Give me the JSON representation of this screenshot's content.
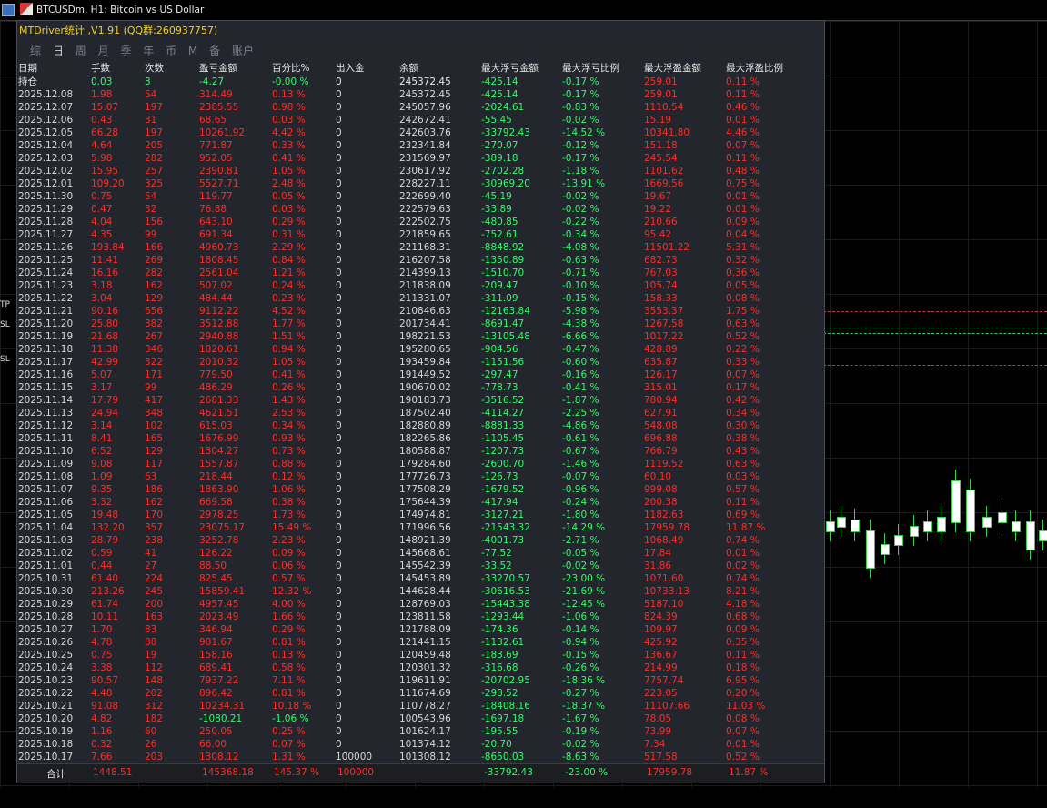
{
  "window": {
    "title": "BTCUSDm, H1:  Bitcoin vs US Dollar"
  },
  "panel": {
    "title": "MTDriver统计 ,V1.91 (QQ群:260937757)",
    "tabs": [
      "综",
      "日",
      "周",
      "月",
      "季",
      "年",
      "币",
      "M",
      "备",
      "账户"
    ],
    "active_tab": "日",
    "side_tag": "移"
  },
  "left_tags": [
    "TP",
    "SL",
    "SL"
  ],
  "table": {
    "headers": [
      "日期",
      "手数",
      "次数",
      "盈亏金额",
      "百分比%",
      "出入金",
      "余额",
      "最大浮亏金额",
      "最大浮亏比例",
      "最大浮盈金额",
      "最大浮盈比例"
    ],
    "holding": [
      "持仓",
      "0.03",
      "3",
      "-4.27",
      "-0.00 %",
      "0",
      "245372.45",
      "-425.14",
      "-0.17 %",
      "259.01",
      "0.11 %"
    ],
    "rows": [
      [
        "2025.12.08",
        "1.98",
        "54",
        "314.49",
        "0.13 %",
        "0",
        "245372.45",
        "-425.14",
        "-0.17 %",
        "259.01",
        "0.11 %"
      ],
      [
        "2025.12.07",
        "15.07",
        "197",
        "2385.55",
        "0.98 %",
        "0",
        "245057.96",
        "-2024.61",
        "-0.83 %",
        "1110.54",
        "0.46 %"
      ],
      [
        "2025.12.06",
        "0.43",
        "31",
        "68.65",
        "0.03 %",
        "0",
        "242672.41",
        "-55.45",
        "-0.02 %",
        "15.19",
        "0.01 %"
      ],
      [
        "2025.12.05",
        "66.28",
        "197",
        "10261.92",
        "4.42 %",
        "0",
        "242603.76",
        "-33792.43",
        "-14.52 %",
        "10341.80",
        "4.46 %"
      ],
      [
        "2025.12.04",
        "4.64",
        "205",
        "771.87",
        "0.33 %",
        "0",
        "232341.84",
        "-270.07",
        "-0.12 %",
        "151.18",
        "0.07 %"
      ],
      [
        "2025.12.03",
        "5.98",
        "282",
        "952.05",
        "0.41 %",
        "0",
        "231569.97",
        "-389.18",
        "-0.17 %",
        "245.54",
        "0.11 %"
      ],
      [
        "2025.12.02",
        "15.95",
        "257",
        "2390.81",
        "1.05 %",
        "0",
        "230617.92",
        "-2702.28",
        "-1.18 %",
        "1101.62",
        "0.48 %"
      ],
      [
        "2025.12.01",
        "109.20",
        "325",
        "5527.71",
        "2.48 %",
        "0",
        "228227.11",
        "-30969.20",
        "-13.91 %",
        "1669.56",
        "0.75 %"
      ],
      [
        "2025.11.30",
        "0.75",
        "54",
        "119.77",
        "0.05 %",
        "0",
        "222699.40",
        "-45.19",
        "-0.02 %",
        "19.67",
        "0.01 %"
      ],
      [
        "2025.11.29",
        "0.47",
        "32",
        "76.88",
        "0.03 %",
        "0",
        "222579.63",
        "-33.89",
        "-0.02 %",
        "19.22",
        "0.01 %"
      ],
      [
        "2025.11.28",
        "4.04",
        "156",
        "643.10",
        "0.29 %",
        "0",
        "222502.75",
        "-480.85",
        "-0.22 %",
        "210.66",
        "0.09 %"
      ],
      [
        "2025.11.27",
        "4.35",
        "99",
        "691.34",
        "0.31 %",
        "0",
        "221859.65",
        "-752.61",
        "-0.34 %",
        "95.42",
        "0.04 %"
      ],
      [
        "2025.11.26",
        "193.84",
        "166",
        "4960.73",
        "2.29 %",
        "0",
        "221168.31",
        "-8848.92",
        "-4.08 %",
        "11501.22",
        "5.31 %"
      ],
      [
        "2025.11.25",
        "11.41",
        "269",
        "1808.45",
        "0.84 %",
        "0",
        "216207.58",
        "-1350.89",
        "-0.63 %",
        "682.73",
        "0.32 %"
      ],
      [
        "2025.11.24",
        "16.16",
        "282",
        "2561.04",
        "1.21 %",
        "0",
        "214399.13",
        "-1510.70",
        "-0.71 %",
        "767.03",
        "0.36 %"
      ],
      [
        "2025.11.23",
        "3.18",
        "162",
        "507.02",
        "0.24 %",
        "0",
        "211838.09",
        "-209.47",
        "-0.10 %",
        "105.74",
        "0.05 %"
      ],
      [
        "2025.11.22",
        "3.04",
        "129",
        "484.44",
        "0.23 %",
        "0",
        "211331.07",
        "-311.09",
        "-0.15 %",
        "158.33",
        "0.08 %"
      ],
      [
        "2025.11.21",
        "90.16",
        "656",
        "9112.22",
        "4.52 %",
        "0",
        "210846.63",
        "-12163.84",
        "-5.98 %",
        "3553.37",
        "1.75 %"
      ],
      [
        "2025.11.20",
        "25.80",
        "382",
        "3512.88",
        "1.77 %",
        "0",
        "201734.41",
        "-8691.47",
        "-4.38 %",
        "1267.58",
        "0.63 %"
      ],
      [
        "2025.11.19",
        "21.68",
        "267",
        "2940.88",
        "1.51 %",
        "0",
        "198221.53",
        "-13105.48",
        "-6.66 %",
        "1017.22",
        "0.52 %"
      ],
      [
        "2025.11.18",
        "11.38",
        "346",
        "1820.61",
        "0.94 %",
        "0",
        "195280.65",
        "-904.56",
        "-0.47 %",
        "428.89",
        "0.22 %"
      ],
      [
        "2025.11.17",
        "42.99",
        "322",
        "2010.32",
        "1.05 %",
        "0",
        "193459.84",
        "-1151.56",
        "-0.60 %",
        "635.87",
        "0.33 %"
      ],
      [
        "2025.11.16",
        "5.07",
        "171",
        "779.50",
        "0.41 %",
        "0",
        "191449.52",
        "-297.47",
        "-0.16 %",
        "126.17",
        "0.07 %"
      ],
      [
        "2025.11.15",
        "3.17",
        "99",
        "486.29",
        "0.26 %",
        "0",
        "190670.02",
        "-778.73",
        "-0.41 %",
        "315.01",
        "0.17 %"
      ],
      [
        "2025.11.14",
        "17.79",
        "417",
        "2681.33",
        "1.43 %",
        "0",
        "190183.73",
        "-3516.52",
        "-1.87 %",
        "780.94",
        "0.42 %"
      ],
      [
        "2025.11.13",
        "24.94",
        "348",
        "4621.51",
        "2.53 %",
        "0",
        "187502.40",
        "-4114.27",
        "-2.25 %",
        "627.91",
        "0.34 %"
      ],
      [
        "2025.11.12",
        "3.14",
        "102",
        "615.03",
        "0.34 %",
        "0",
        "182880.89",
        "-8881.33",
        "-4.86 %",
        "548.08",
        "0.30 %"
      ],
      [
        "2025.11.11",
        "8.41",
        "165",
        "1676.99",
        "0.93 %",
        "0",
        "182265.86",
        "-1105.45",
        "-0.61 %",
        "696.88",
        "0.38 %"
      ],
      [
        "2025.11.10",
        "6.52",
        "129",
        "1304.27",
        "0.73 %",
        "0",
        "180588.87",
        "-1207.73",
        "-0.67 %",
        "766.79",
        "0.43 %"
      ],
      [
        "2025.11.09",
        "9.08",
        "117",
        "1557.87",
        "0.88 %",
        "0",
        "179284.60",
        "-2600.70",
        "-1.46 %",
        "1119.52",
        "0.63 %"
      ],
      [
        "2025.11.08",
        "1.09",
        "63",
        "218.44",
        "0.12 %",
        "0",
        "177726.73",
        "-126.73",
        "-0.07 %",
        "60.10",
        "0.03 %"
      ],
      [
        "2025.11.07",
        "9.35",
        "186",
        "1863.90",
        "1.06 %",
        "0",
        "177508.29",
        "-1679.52",
        "-0.96 %",
        "999.08",
        "0.57 %"
      ],
      [
        "2025.11.06",
        "3.32",
        "162",
        "669.58",
        "0.38 %",
        "0",
        "175644.39",
        "-417.94",
        "-0.24 %",
        "200.38",
        "0.11 %"
      ],
      [
        "2025.11.05",
        "19.48",
        "170",
        "2978.25",
        "1.73 %",
        "0",
        "174974.81",
        "-3127.21",
        "-1.80 %",
        "1182.63",
        "0.69 %"
      ],
      [
        "2025.11.04",
        "132.20",
        "357",
        "23075.17",
        "15.49 %",
        "0",
        "171996.56",
        "-21543.32",
        "-14.29 %",
        "17959.78",
        "11.87 %"
      ],
      [
        "2025.11.03",
        "28.79",
        "238",
        "3252.78",
        "2.23 %",
        "0",
        "148921.39",
        "-4001.73",
        "-2.71 %",
        "1068.49",
        "0.74 %"
      ],
      [
        "2025.11.02",
        "0.59",
        "41",
        "126.22",
        "0.09 %",
        "0",
        "145668.61",
        "-77.52",
        "-0.05 %",
        "17.84",
        "0.01 %"
      ],
      [
        "2025.11.01",
        "0.44",
        "27",
        "88.50",
        "0.06 %",
        "0",
        "145542.39",
        "-33.52",
        "-0.02 %",
        "31.86",
        "0.02 %"
      ],
      [
        "2025.10.31",
        "61.40",
        "224",
        "825.45",
        "0.57 %",
        "0",
        "145453.89",
        "-33270.57",
        "-23.00 %",
        "1071.60",
        "0.74 %"
      ],
      [
        "2025.10.30",
        "213.26",
        "245",
        "15859.41",
        "12.32 %",
        "0",
        "144628.44",
        "-30616.53",
        "-21.69 %",
        "10733.13",
        "8.21 %"
      ],
      [
        "2025.10.29",
        "61.74",
        "200",
        "4957.45",
        "4.00 %",
        "0",
        "128769.03",
        "-15443.38",
        "-12.45 %",
        "5187.10",
        "4.18 %"
      ],
      [
        "2025.10.28",
        "10.11",
        "163",
        "2023.49",
        "1.66 %",
        "0",
        "123811.58",
        "-1293.44",
        "-1.06 %",
        "824.39",
        "0.68 %"
      ],
      [
        "2025.10.27",
        "1.70",
        "83",
        "346.94",
        "0.29 %",
        "0",
        "121788.09",
        "-174.36",
        "-0.14 %",
        "109.97",
        "0.09 %"
      ],
      [
        "2025.10.26",
        "4.78",
        "88",
        "981.67",
        "0.81 %",
        "0",
        "121441.15",
        "-1132.61",
        "-0.94 %",
        "425.92",
        "0.35 %"
      ],
      [
        "2025.10.25",
        "0.75",
        "19",
        "158.16",
        "0.13 %",
        "0",
        "120459.48",
        "-183.69",
        "-0.15 %",
        "136.67",
        "0.11 %"
      ],
      [
        "2025.10.24",
        "3.38",
        "112",
        "689.41",
        "0.58 %",
        "0",
        "120301.32",
        "-316.68",
        "-0.26 %",
        "214.99",
        "0.18 %"
      ],
      [
        "2025.10.23",
        "90.57",
        "148",
        "7937.22",
        "7.11 %",
        "0",
        "119611.91",
        "-20702.95",
        "-18.36 %",
        "7757.74",
        "6.95 %"
      ],
      [
        "2025.10.22",
        "4.48",
        "202",
        "896.42",
        "0.81 %",
        "0",
        "111674.69",
        "-298.52",
        "-0.27 %",
        "223.05",
        "0.20 %"
      ],
      [
        "2025.10.21",
        "91.08",
        "312",
        "10234.31",
        "10.18 %",
        "0",
        "110778.27",
        "-18408.16",
        "-18.37 %",
        "11107.66",
        "11.03 %"
      ],
      [
        "2025.10.20",
        "4.82",
        "182",
        "-1080.21",
        "-1.06 %",
        "0",
        "100543.96",
        "-1697.18",
        "-1.67 %",
        "78.05",
        "0.08 %"
      ],
      [
        "2025.10.19",
        "1.16",
        "60",
        "250.05",
        "0.25 %",
        "0",
        "101624.17",
        "-195.55",
        "-0.19 %",
        "73.99",
        "0.07 %"
      ],
      [
        "2025.10.18",
        "0.32",
        "26",
        "66.00",
        "0.07 %",
        "0",
        "101374.12",
        "-20.70",
        "-0.02 %",
        "7.34",
        "0.01 %"
      ],
      [
        "2025.10.17",
        "7.66",
        "203",
        "1308.12",
        "1.31 %",
        "100000",
        "101308.12",
        "-8650.03",
        "-8.63 %",
        "517.58",
        "0.52 %"
      ]
    ]
  },
  "footer": [
    "合计",
    "1448.51",
    "",
    "145368.18",
    "145.37 %",
    "100000",
    "",
    "-33792.43",
    "-23.00 %",
    "17959.78",
    "11.87 %"
  ],
  "colors": {
    "profit": "#ff2b2b",
    "loss": "#2bff6a",
    "neutral": "#d6d6d6",
    "title": "#f0d020",
    "panel": "#23262c"
  }
}
